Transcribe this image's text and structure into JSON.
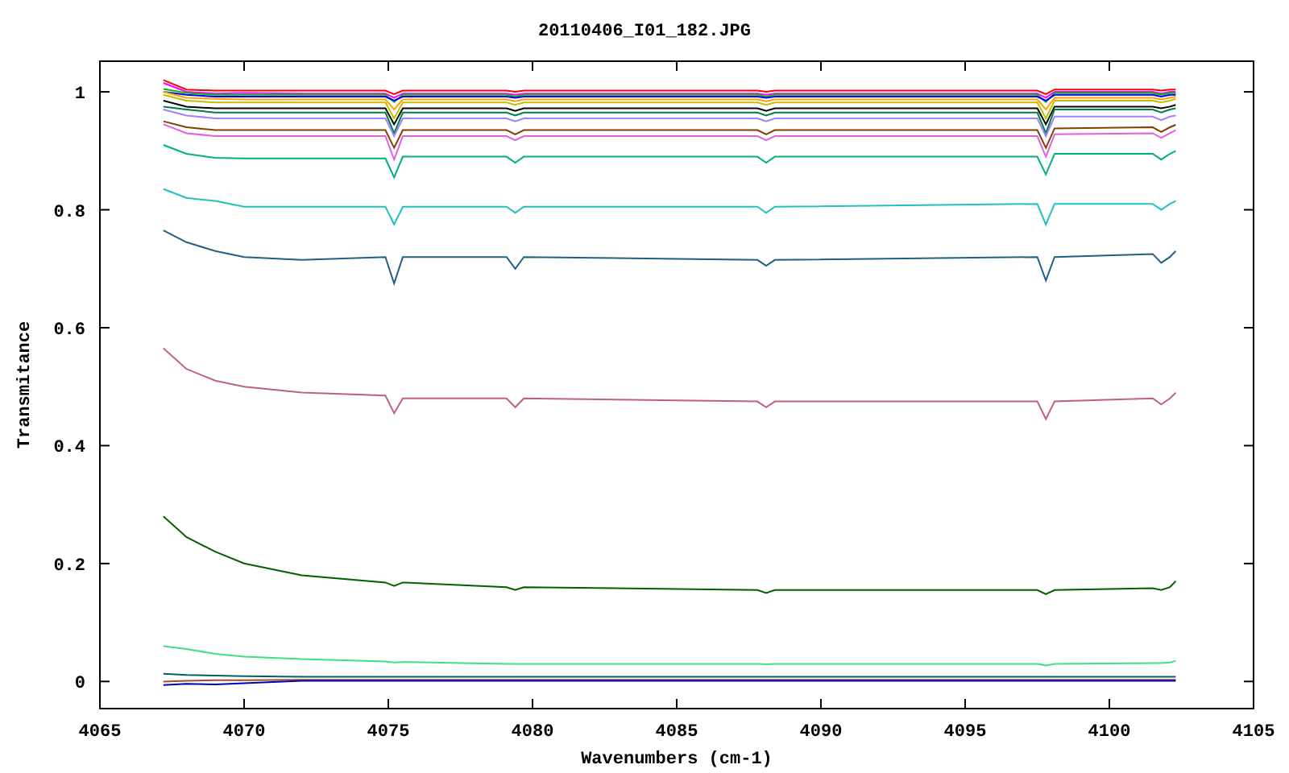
{
  "chart": {
    "chart_data": {
      "type": "line",
      "title": "20110406_I01_182.JPG",
      "xlabel": "Wavenumbers (cm-1)",
      "ylabel": "Transmitance",
      "x": [
        4067.2,
        4068,
        4069,
        4070,
        4072,
        4074.9,
        4075.2,
        4075.5,
        4079.1,
        4079.4,
        4079.7,
        4087.8,
        4088.1,
        4088.4,
        4097.5,
        4097.8,
        4098.1,
        4101.5,
        4101.8,
        4102.1,
        4102.3
      ],
      "xlim": [
        4065,
        4105
      ],
      "ylim": [
        -0.046,
        1.052
      ],
      "xticks": [
        4065,
        4070,
        4075,
        4080,
        4085,
        4090,
        4095,
        4100,
        4105
      ],
      "yticks": [
        {
          "value": 0,
          "label": "0"
        },
        {
          "value": 0.2,
          "label": "0.2"
        },
        {
          "value": 0.4,
          "label": "0.4"
        },
        {
          "value": 0.6,
          "label": "0.6"
        },
        {
          "value": 0.8,
          "label": "0.8"
        },
        {
          "value": 1,
          "label": "1"
        }
      ],
      "series": [
        {
          "color": "#ff0000",
          "values": [
            1.02,
            1.004,
            1.002,
            1.002,
            1.002,
            1.002,
            0.996,
            1.002,
            1.002,
            1.0,
            1.002,
            1.002,
            1.0,
            1.002,
            1.002,
            0.996,
            1.004,
            1.004,
            1.002,
            1.004,
            1.004
          ]
        },
        {
          "color": "#ff00ff",
          "values": [
            1.015,
            1.0,
            0.997,
            0.998,
            0.997,
            0.997,
            0.99,
            0.997,
            0.997,
            0.995,
            0.997,
            0.997,
            0.995,
            0.997,
            0.997,
            0.99,
            1.0,
            1.0,
            0.997,
            1.0,
            1.0
          ]
        },
        {
          "color": "#00c000",
          "values": [
            1.005,
            0.998,
            0.995,
            0.995,
            0.995,
            0.995,
            0.983,
            0.995,
            0.995,
            0.992,
            0.995,
            0.995,
            0.992,
            0.995,
            0.995,
            0.983,
            0.998,
            0.998,
            0.995,
            0.998,
            0.998
          ]
        },
        {
          "color": "#0000ff",
          "values": [
            1.0,
            0.995,
            0.992,
            0.992,
            0.992,
            0.992,
            0.985,
            0.992,
            0.992,
            0.99,
            0.992,
            0.992,
            0.99,
            0.992,
            0.992,
            0.985,
            0.995,
            0.995,
            0.992,
            0.995,
            0.995
          ]
        },
        {
          "color": "#ffa000",
          "values": [
            1.0,
            0.99,
            0.988,
            0.987,
            0.987,
            0.987,
            0.97,
            0.987,
            0.987,
            0.984,
            0.987,
            0.987,
            0.984,
            0.987,
            0.987,
            0.97,
            0.99,
            0.99,
            0.987,
            0.99,
            0.992
          ]
        },
        {
          "color": "#c0c000",
          "values": [
            0.995,
            0.985,
            0.982,
            0.982,
            0.982,
            0.982,
            0.955,
            0.982,
            0.982,
            0.978,
            0.982,
            0.982,
            0.978,
            0.982,
            0.982,
            0.955,
            0.985,
            0.985,
            0.982,
            0.985,
            0.988
          ]
        },
        {
          "color": "#000000",
          "values": [
            0.985,
            0.975,
            0.972,
            0.972,
            0.972,
            0.972,
            0.945,
            0.972,
            0.972,
            0.968,
            0.972,
            0.972,
            0.968,
            0.972,
            0.972,
            0.945,
            0.975,
            0.975,
            0.972,
            0.975,
            0.978
          ]
        },
        {
          "color": "#008040",
          "values": [
            0.975,
            0.97,
            0.965,
            0.965,
            0.965,
            0.965,
            0.93,
            0.965,
            0.965,
            0.96,
            0.965,
            0.965,
            0.96,
            0.965,
            0.965,
            0.93,
            0.97,
            0.97,
            0.965,
            0.97,
            0.972
          ]
        },
        {
          "color": "#a080ff",
          "values": [
            0.97,
            0.96,
            0.955,
            0.955,
            0.955,
            0.955,
            0.925,
            0.955,
            0.955,
            0.95,
            0.955,
            0.955,
            0.95,
            0.955,
            0.955,
            0.925,
            0.958,
            0.958,
            0.952,
            0.958,
            0.96
          ]
        },
        {
          "color": "#804000",
          "values": [
            0.95,
            0.94,
            0.935,
            0.935,
            0.935,
            0.935,
            0.905,
            0.935,
            0.935,
            0.928,
            0.935,
            0.935,
            0.928,
            0.935,
            0.935,
            0.905,
            0.938,
            0.94,
            0.932,
            0.94,
            0.944
          ]
        },
        {
          "color": "#e060e0",
          "values": [
            0.945,
            0.93,
            0.925,
            0.925,
            0.925,
            0.925,
            0.885,
            0.925,
            0.925,
            0.918,
            0.925,
            0.925,
            0.918,
            0.925,
            0.925,
            0.89,
            0.928,
            0.93,
            0.922,
            0.93,
            0.935
          ]
        },
        {
          "color": "#00b080",
          "values": [
            0.91,
            0.895,
            0.888,
            0.887,
            0.887,
            0.887,
            0.855,
            0.89,
            0.89,
            0.88,
            0.89,
            0.89,
            0.88,
            0.89,
            0.89,
            0.86,
            0.895,
            0.895,
            0.885,
            0.895,
            0.9
          ]
        },
        {
          "color": "#20c0c0",
          "values": [
            0.835,
            0.82,
            0.815,
            0.805,
            0.805,
            0.805,
            0.775,
            0.805,
            0.805,
            0.795,
            0.805,
            0.805,
            0.795,
            0.805,
            0.81,
            0.775,
            0.81,
            0.81,
            0.8,
            0.81,
            0.815
          ]
        },
        {
          "color": "#206080",
          "values": [
            0.765,
            0.745,
            0.73,
            0.72,
            0.715,
            0.72,
            0.675,
            0.72,
            0.72,
            0.7,
            0.72,
            0.715,
            0.705,
            0.715,
            0.72,
            0.68,
            0.72,
            0.725,
            0.71,
            0.72,
            0.73
          ]
        },
        {
          "color": "#c06080",
          "values": [
            0.565,
            0.53,
            0.51,
            0.5,
            0.49,
            0.485,
            0.455,
            0.48,
            0.48,
            0.465,
            0.48,
            0.475,
            0.465,
            0.475,
            0.475,
            0.445,
            0.475,
            0.48,
            0.47,
            0.48,
            0.49
          ]
        },
        {
          "color": "#006000",
          "values": [
            0.28,
            0.245,
            0.22,
            0.2,
            0.18,
            0.168,
            0.162,
            0.168,
            0.16,
            0.155,
            0.16,
            0.155,
            0.15,
            0.155,
            0.155,
            0.148,
            0.155,
            0.158,
            0.155,
            0.16,
            0.17
          ]
        },
        {
          "color": "#40e080",
          "values": [
            0.06,
            0.055,
            0.047,
            0.042,
            0.038,
            0.034,
            0.032,
            0.033,
            0.03,
            0.03,
            0.03,
            0.03,
            0.029,
            0.03,
            0.03,
            0.027,
            0.03,
            0.031,
            0.031,
            0.032,
            0.035
          ]
        },
        {
          "color": "#006060",
          "values": [
            0.013,
            0.011,
            0.01,
            0.009,
            0.008,
            0.008,
            0.008,
            0.008,
            0.008,
            0.008,
            0.008,
            0.008,
            0.008,
            0.008,
            0.008,
            0.008,
            0.008,
            0.008,
            0.008,
            0.008,
            0.008
          ]
        },
        {
          "color": "#a05020",
          "values": [
            0.0,
            0.001,
            0.002,
            0.002,
            0.003,
            0.003,
            0.003,
            0.003,
            0.003,
            0.003,
            0.003,
            0.003,
            0.003,
            0.003,
            0.003,
            0.003,
            0.003,
            0.003,
            0.003,
            0.003,
            0.003
          ]
        },
        {
          "color": "#0000c0",
          "values": [
            -0.006,
            -0.004,
            -0.005,
            -0.003,
            0.001,
            0.001,
            0.001,
            0.001,
            0.001,
            0.001,
            0.001,
            0.001,
            0.001,
            0.001,
            0.001,
            0.001,
            0.001,
            0.001,
            0.001,
            0.001,
            0.001
          ]
        }
      ]
    }
  }
}
